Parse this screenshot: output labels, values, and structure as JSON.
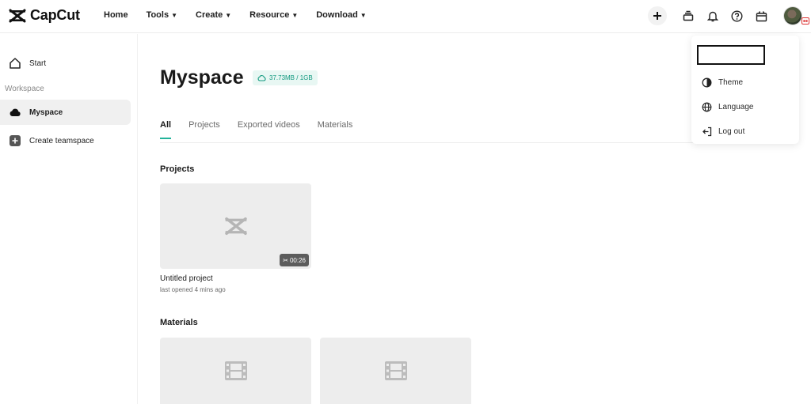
{
  "app": {
    "name": "CapCut"
  },
  "nav": {
    "items": [
      {
        "label": "Home",
        "dropdown": false
      },
      {
        "label": "Tools",
        "dropdown": true
      },
      {
        "label": "Create",
        "dropdown": true
      },
      {
        "label": "Resource",
        "dropdown": true
      },
      {
        "label": "Download",
        "dropdown": true
      }
    ]
  },
  "toolbar": {
    "icons": [
      "plus-icon",
      "layers-icon",
      "bell-icon",
      "help-icon",
      "gift-icon"
    ]
  },
  "sidebar": {
    "start": "Start",
    "section": "Workspace",
    "myspace": "Myspace",
    "create_teamspace": "Create teamspace"
  },
  "main": {
    "title": "Myspace",
    "storage": "37.73MB / 1GB",
    "tabs": [
      {
        "label": "All",
        "active": true
      },
      {
        "label": "Projects",
        "active": false
      },
      {
        "label": "Exported videos",
        "active": false
      },
      {
        "label": "Materials",
        "active": false
      }
    ],
    "projects_heading": "Projects",
    "project": {
      "name": "Untitled project",
      "meta": "last opened 4 mins ago",
      "duration": "00:26"
    },
    "materials_heading": "Materials"
  },
  "menu": {
    "items": [
      {
        "label": "Theme",
        "icon": "theme-icon"
      },
      {
        "label": "Language",
        "icon": "globe-icon"
      },
      {
        "label": "Log out",
        "icon": "logout-icon"
      }
    ]
  },
  "colors": {
    "accent": "#23b39a",
    "storage_bg": "#e8f7f3",
    "storage_text": "#139a80"
  }
}
